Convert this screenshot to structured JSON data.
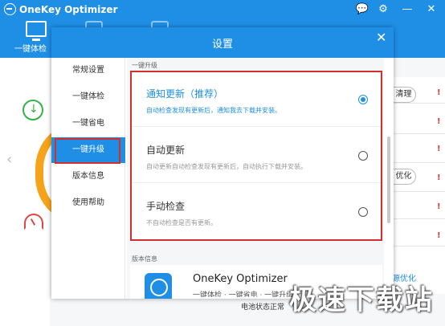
{
  "app": {
    "title": "OneKey Optimizer",
    "toolbar_label": "一键体检",
    "chat_icon": "💬",
    "gear_icon": "⚙",
    "minimize_icon": "—",
    "close_icon": "✕"
  },
  "background": {
    "buttons": [
      "清理",
      "优化"
    ],
    "warn": "!",
    "link": "源优化",
    "battery_status": "电池状态正常",
    "arrow_left": "‹"
  },
  "dialog": {
    "title": "设置",
    "close_icon": "✕",
    "nav": [
      "常规设置",
      "一键体检",
      "一键省电",
      "一键升级",
      "版本信息",
      "使用帮助"
    ],
    "active_nav_index": 3,
    "section_upgrade": "一键升级",
    "options": [
      {
        "title": "通知更新（推荐）",
        "desc": "自动检查发现有更新后，通知我去下载并安装。",
        "checked": true
      },
      {
        "title": "自动更新",
        "desc": "自动更新自动检查发现有更新后，自动执行下载并安装。",
        "checked": false
      },
      {
        "title": "手动检查",
        "desc": "不自动检查是否有更新。",
        "checked": false
      }
    ],
    "section_version": "版本信息",
    "version_name": "OneKey Optimizer",
    "version_sub": "一键体检 · 一键省电 · 一键升级"
  },
  "watermark": "极速下载站",
  "colors": {
    "accent": "#1f8fe6",
    "highlight": "#d42f2f",
    "orange": "#f7a21b",
    "green": "#35b24a"
  }
}
